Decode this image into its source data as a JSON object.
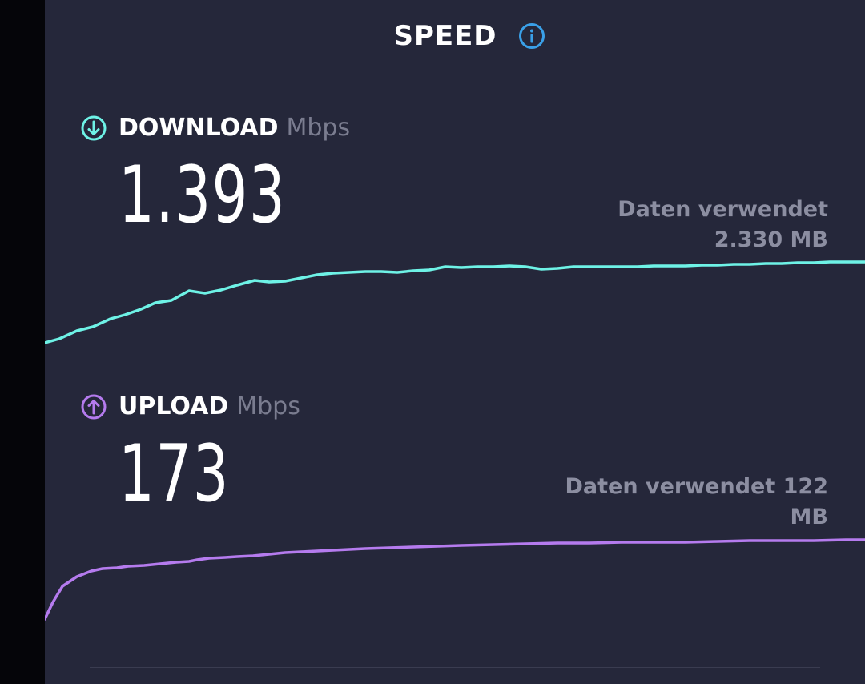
{
  "header": {
    "title": "SPEED",
    "info_icon": "info-icon",
    "info_color": "#3aa0e8"
  },
  "download": {
    "label": "DOWNLOAD",
    "unit": "Mbps",
    "value": "1.393",
    "data_used_line1": "Daten verwendet",
    "data_used_line2": "2.330 MB",
    "icon": "arrow-down-circle-icon",
    "color": "#6ef2e6"
  },
  "upload": {
    "label": "UPLOAD",
    "unit": "Mbps",
    "value": "173",
    "data_used_line1": "Daten verwendet 122",
    "data_used_line2": "MB",
    "icon": "arrow-up-circle-icon",
    "color": "#b57bee"
  }
}
